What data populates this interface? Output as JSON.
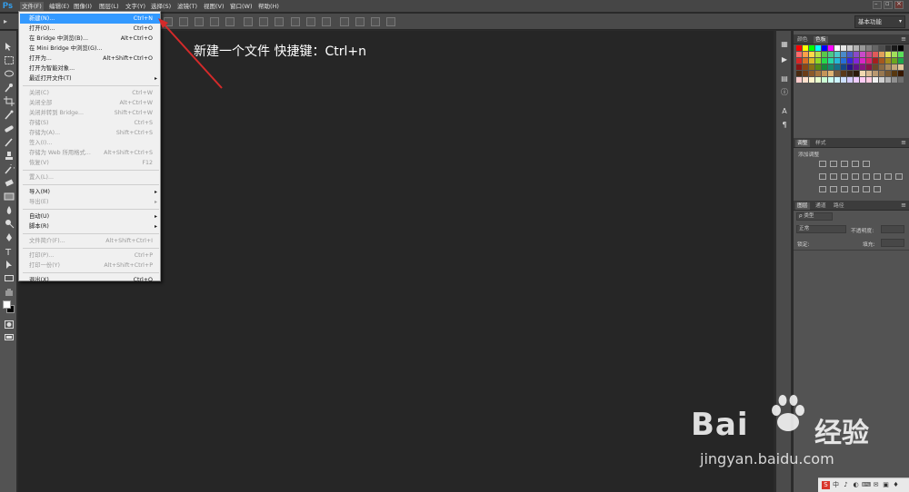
{
  "app": {
    "logo": "Ps",
    "brand_color": "#31a8ff"
  },
  "menubar": {
    "items": [
      "文件(F)",
      "编辑(E)",
      "图像(I)",
      "图层(L)",
      "文字(Y)",
      "选择(S)",
      "滤镜(T)",
      "视图(V)",
      "窗口(W)",
      "帮助(H)"
    ],
    "active_index": 0,
    "window_buttons": [
      "minimize",
      "restore",
      "close"
    ]
  },
  "optbar": {
    "workspace": "基本功能"
  },
  "file_menu": {
    "highlight_color": "#3399ff",
    "items": [
      {
        "label": "新建(N)...",
        "shortcut": "Ctrl+N",
        "highlighted": true
      },
      {
        "label": "打开(O)...",
        "shortcut": "Ctrl+O"
      },
      {
        "label": "在 Bridge 中浏览(B)...",
        "shortcut": "Alt+Ctrl+O"
      },
      {
        "label": "在 Mini Bridge 中浏览(G)...",
        "shortcut": ""
      },
      {
        "label": "打开为...",
        "shortcut": "Alt+Shift+Ctrl+O"
      },
      {
        "label": "打开为智能对象...",
        "shortcut": ""
      },
      {
        "label": "最近打开文件(T)",
        "shortcut": "",
        "submenu": true
      },
      {
        "label": "关闭(C)",
        "shortcut": "Ctrl+W",
        "disabled": true
      },
      {
        "label": "关闭全部",
        "shortcut": "Alt+Ctrl+W",
        "disabled": true
      },
      {
        "label": "关闭并转到 Bridge...",
        "shortcut": "Shift+Ctrl+W",
        "disabled": true
      },
      {
        "label": "存储(S)",
        "shortcut": "Ctrl+S",
        "disabled": true
      },
      {
        "label": "存储为(A)...",
        "shortcut": "Shift+Ctrl+S",
        "disabled": true
      },
      {
        "label": "签入(I)...",
        "shortcut": "",
        "disabled": true
      },
      {
        "label": "存储为 Web 所用格式...",
        "shortcut": "Alt+Shift+Ctrl+S",
        "disabled": true
      },
      {
        "label": "恢复(V)",
        "shortcut": "F12",
        "disabled": true
      },
      {
        "label": "置入(L)...",
        "shortcut": "",
        "disabled": true
      },
      {
        "label": "导入(M)",
        "shortcut": "",
        "submenu": true
      },
      {
        "label": "导出(E)",
        "shortcut": "",
        "submenu": true,
        "disabled": true
      },
      {
        "label": "自动(U)",
        "shortcut": "",
        "submenu": true
      },
      {
        "label": "脚本(R)",
        "shortcut": "",
        "submenu": true
      },
      {
        "label": "文件简介(F)...",
        "shortcut": "Alt+Shift+Ctrl+I",
        "disabled": true
      },
      {
        "label": "打印(P)...",
        "shortcut": "Ctrl+P",
        "disabled": true
      },
      {
        "label": "打印一份(Y)",
        "shortcut": "Alt+Shift+Ctrl+P",
        "disabled": true
      },
      {
        "label": "退出(X)",
        "shortcut": "Ctrl+Q"
      }
    ]
  },
  "annotation": {
    "text": "新建一个文件  快捷键：Ctrl+n",
    "arrow_color": "#d42a2a"
  },
  "panels": {
    "swatches": {
      "tabs": [
        "颜色",
        "色板"
      ],
      "active": 1
    },
    "adjustments": {
      "tabs": [
        "调整",
        "样式"
      ],
      "title": "添加调整"
    },
    "layers": {
      "tabs": [
        "图层",
        "通道",
        "路径"
      ],
      "filter": "ρ 类型",
      "blend_mode": "正常",
      "opacity_label": "不透明度:",
      "lock_label": "锁定:",
      "fill_label": "填充:"
    }
  },
  "watermark": {
    "brand": "Bai",
    "brand_cn": "经验",
    "url": "jingyan.baidu.com"
  },
  "tray": {
    "items": [
      "S",
      "中",
      "♪",
      "◐",
      "⌨",
      "✉",
      "▣",
      "♦"
    ]
  }
}
